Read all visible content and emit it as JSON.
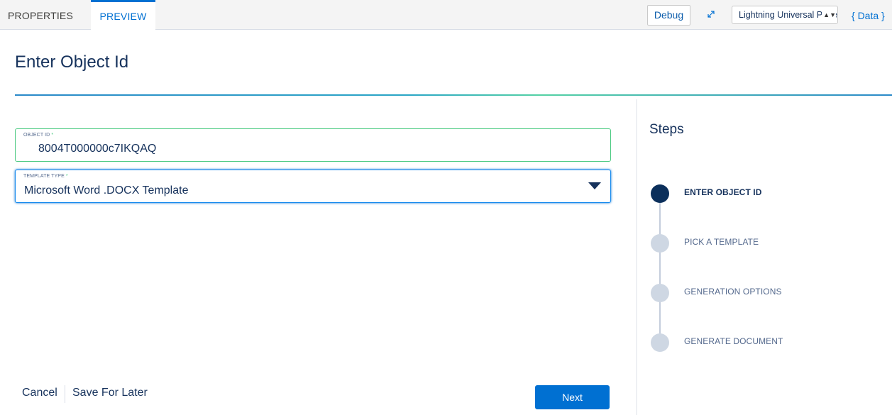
{
  "topbar": {
    "tabs": [
      {
        "label": "PROPERTIES"
      },
      {
        "label": "PREVIEW"
      }
    ],
    "debug_label": "Debug",
    "device_select": "Lightning Universal Page",
    "data_link": "{ Data }"
  },
  "page": {
    "title": "Enter Object Id"
  },
  "form": {
    "object_id": {
      "label": "OBJECT ID",
      "required_mark": "*",
      "value": "8004T000000c7IKQAQ"
    },
    "template_type": {
      "label": "TEMPLATE TYPE",
      "required_mark": "*",
      "value": "Microsoft Word .DOCX Template"
    }
  },
  "footer": {
    "cancel_label": "Cancel",
    "save_later_label": "Save For Later",
    "next_label": "Next"
  },
  "steps": {
    "title": "Steps",
    "items": [
      {
        "label": "ENTER OBJECT ID",
        "active": true
      },
      {
        "label": "PICK A TEMPLATE",
        "active": false
      },
      {
        "label": "GENERATION OPTIONS",
        "active": false
      },
      {
        "label": "GENERATE DOCUMENT",
        "active": false
      }
    ]
  },
  "colors": {
    "accent": "#0070d2",
    "title_text": "#16325c",
    "active_step": "#0b2f5b",
    "inactive_step": "#ced7e3",
    "required": "#4bca81"
  }
}
